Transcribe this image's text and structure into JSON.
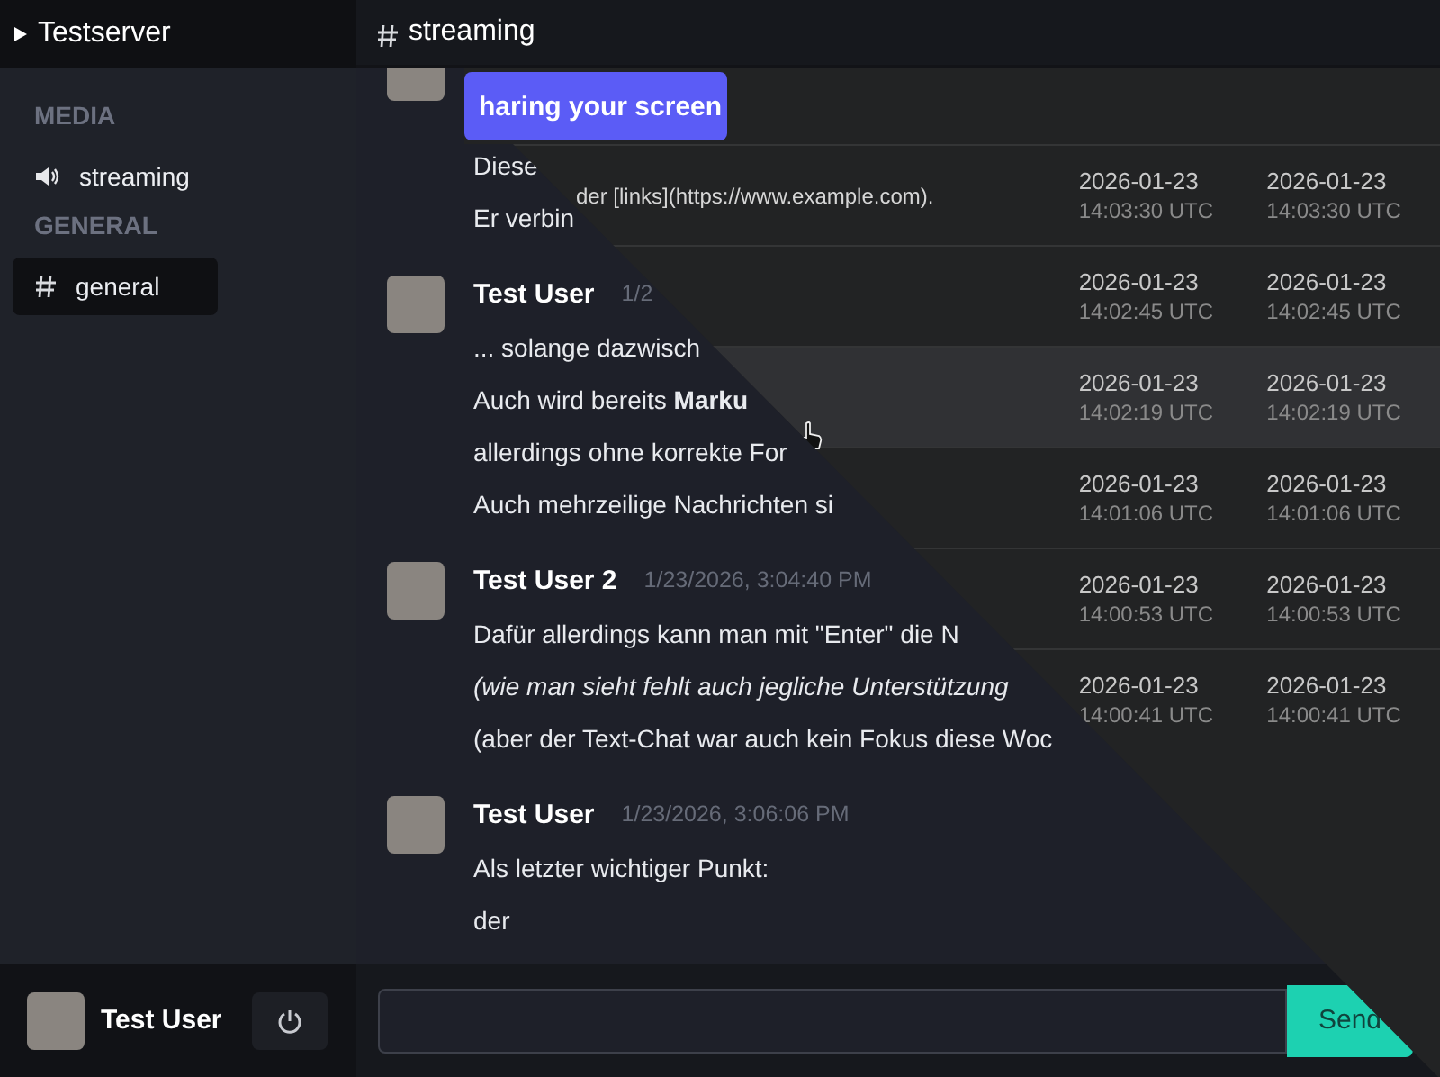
{
  "server": {
    "name": "Testserver"
  },
  "sidebar": {
    "sections": [
      {
        "title": "MEDIA",
        "channels": [
          {
            "kind": "voice",
            "name": "streaming",
            "selected": false
          }
        ]
      },
      {
        "title": "GENERAL",
        "channels": [
          {
            "kind": "text",
            "name": "general",
            "selected": true
          }
        ]
      }
    ]
  },
  "user_panel": {
    "name": "Test User"
  },
  "header": {
    "channel": "streaming"
  },
  "messages": [
    {
      "lines": [
        {
          "text": "Diese",
          "italic": false
        },
        {
          "text": "Er verbin",
          "italic": false
        }
      ]
    },
    {
      "author": "Test User",
      "time": "1/2",
      "lines": [
        {
          "text": "... solange dazwisch",
          "italic": false
        },
        {
          "text": "Auch wird bereits **Marku**",
          "italic": false
        },
        {
          "text": "allerdings ohne korrekte For",
          "italic": false
        },
        {
          "text": "Auch mehrzeilige Nachrichten si",
          "italic": false
        }
      ]
    },
    {
      "author": "Test User 2",
      "time": "1/23/2026, 3:04:40 PM",
      "lines": [
        {
          "text": "Dafür allerdings kann man mit \"Enter\" die N",
          "italic": false
        },
        {
          "text": "(wie man sieht fehlt auch jegliche Unterstützung",
          "italic": true
        },
        {
          "text": "(aber der Text-Chat war auch kein Fokus diese Woc",
          "italic": false
        }
      ]
    },
    {
      "author": "Test User",
      "time": "1/23/2026, 3:06:06 PM",
      "lines": [
        {
          "text": "Als letzter wichtiger Punkt:",
          "italic": false
        },
        {
          "text": "der",
          "italic": false
        }
      ]
    }
  ],
  "composer": {
    "button": "Send"
  },
  "overlay_panel": {
    "button": "haring your screen",
    "rows": [
      {
        "text": "der [links](https://www.example.com).",
        "hovered": false,
        "stamps": [
          {
            "date": "2026-01-23",
            "time": "14:03:30 UTC"
          },
          {
            "date": "2026-01-23",
            "time": "14:03:30 UTC"
          }
        ]
      },
      {
        "hovered": false,
        "stamps": [
          {
            "date": "2026-01-23",
            "time": "14:02:45 UTC"
          },
          {
            "date": "2026-01-23",
            "time": "14:02:45 UTC"
          }
        ]
      },
      {
        "hovered": true,
        "stamps": [
          {
            "date": "2026-01-23",
            "time": "14:02:19 UTC"
          },
          {
            "date": "2026-01-23",
            "time": "14:02:19 UTC"
          }
        ]
      },
      {
        "hovered": false,
        "stamps": [
          {
            "date": "2026-01-23",
            "time": "14:01:06 UTC"
          },
          {
            "date": "2026-01-23",
            "time": "14:01:06 UTC"
          }
        ]
      },
      {
        "hovered": false,
        "stamps": [
          {
            "date": "2026-01-23",
            "time": "14:00:53 UTC"
          },
          {
            "date": "2026-01-23",
            "time": "14:00:53 UTC"
          }
        ]
      },
      {
        "hovered": false,
        "stamps": [
          {
            "date": "2026-01-23",
            "time": "14:00:41 UTC"
          },
          {
            "date": "2026-01-23",
            "time": "14:00:41 UTC"
          }
        ]
      }
    ]
  }
}
